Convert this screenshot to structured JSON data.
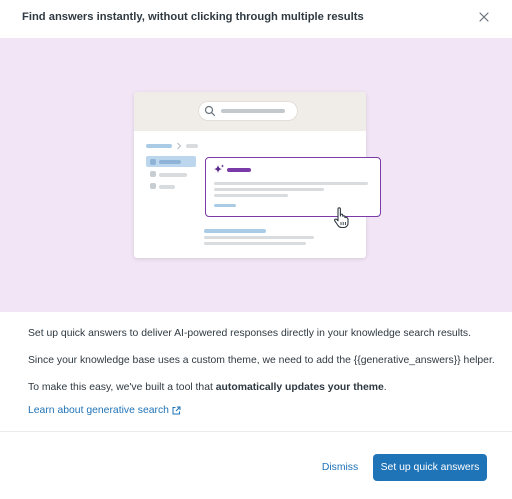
{
  "header": {
    "title": "Find answers instantly, without clicking through multiple results",
    "close_icon": "close-icon"
  },
  "illustration": {
    "icons": [
      "search-icon",
      "sparkle-icon",
      "pointer-hand-icon"
    ],
    "colors": {
      "hero_background": "#f1e5f6",
      "card_header": "#f0ede9",
      "answer_border": "#7a3aa8",
      "sparkle": "#5c2a8c",
      "link_bar": "#a9cbe6",
      "selected_item": "#bcd6ee",
      "placeholder": "#d8dcde"
    }
  },
  "body": {
    "paragraph_1": "Set up quick answers to deliver AI-powered responses directly in your knowledge search results.",
    "paragraph_2": "Since your knowledge base uses a custom theme, we need to add the {{generative_answers}} helper.",
    "paragraph_3_prefix": "To make this easy, we've built a tool that ",
    "paragraph_3_bold": "automatically updates your theme",
    "paragraph_3_suffix": ".",
    "learn_link": "Learn about generative search",
    "external_link_icon": "external-link-icon"
  },
  "footer": {
    "dismiss_label": "Dismiss",
    "primary_label": "Set up quick answers"
  },
  "colors": {
    "primary": "#1f73b7",
    "text": "#2f3941"
  }
}
